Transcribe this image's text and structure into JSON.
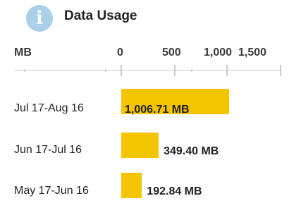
{
  "header": {
    "icon": "info-icon",
    "icon_glyph": "i",
    "title": "Data Usage"
  },
  "colors": {
    "bar": "#f5c400",
    "icon_bg": "#a9cfe9",
    "axis": "#999999"
  },
  "chart_data": {
    "type": "bar",
    "orientation": "horizontal",
    "unit_label": "MB",
    "tick_labels": [
      "0",
      "500",
      "1,000",
      "1,500"
    ],
    "ticks": [
      0,
      500,
      1000,
      1500
    ],
    "xlim": [
      0,
      1500
    ],
    "categories": [
      "Jul 17-Aug 16",
      "Jun 17-Jul 16",
      "May 17-Jun 16"
    ],
    "values": [
      1006.71,
      349.4,
      192.84
    ],
    "value_labels": [
      "1,006.71 MB",
      "349.40 MB",
      "192.84 MB"
    ]
  }
}
